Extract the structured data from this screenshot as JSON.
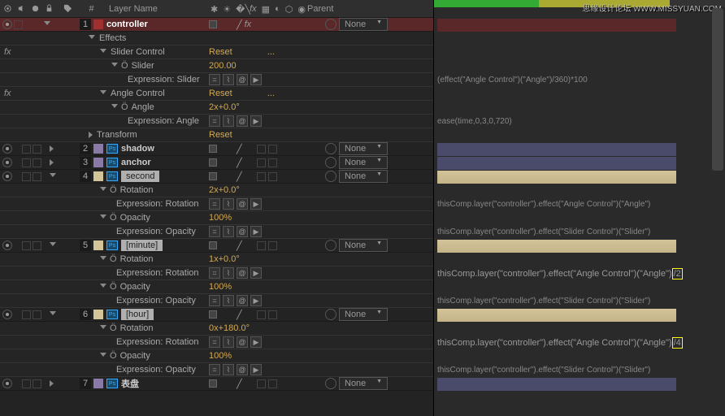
{
  "hdr": {
    "num": "#",
    "name": "Layer Name",
    "parent": "Parent"
  },
  "layers": [
    {
      "n": "1",
      "name": "controller",
      "none": "None",
      "clr": "#a03030"
    },
    {
      "n": "2",
      "name": "shadow",
      "none": "None",
      "clr": "#8a7aa8"
    },
    {
      "n": "3",
      "name": "anchor",
      "none": "None",
      "clr": "#8a7aa8"
    },
    {
      "n": "4",
      "name": "second",
      "none": "None",
      "clr": "#d4c49a"
    },
    {
      "n": "5",
      "name": "[minute]",
      "none": "None",
      "clr": "#d4c49a"
    },
    {
      "n": "6",
      "name": "[hour]",
      "none": "None",
      "clr": "#d4c49a"
    },
    {
      "n": "7",
      "name": "表盘",
      "none": "None",
      "clr": "#8a7aa8"
    }
  ],
  "fx": {
    "effects": "Effects",
    "slider": "Slider Control",
    "sliderP": "Slider",
    "sliderV": "200.00",
    "exprS": "Expression: Slider",
    "angle": "Angle Control",
    "angleP": "Angle",
    "angleV": "2x+0.0°",
    "exprA": "Expression: Angle",
    "transform": "Transform",
    "reset": "Reset"
  },
  "props": {
    "rotation": "Rotation",
    "opacity": "Opacity",
    "exprR": "Expression: Rotation",
    "exprO": "Expression: Opacity",
    "op100": "100%"
  },
  "vals": {
    "r4": "2x+0.0°",
    "r5": "1x+0.0°",
    "r6": "0x+180.0°"
  },
  "exprs": {
    "e1": "(effect(\"Angle Control\")(\"Angle\")/360)*100",
    "e2": "ease(time,0,3,0,720)",
    "e3": "thisComp.layer(\"controller\").effect(\"Angle Control\")(\"Angle\")",
    "e4": "thisComp.layer(\"controller\").effect(\"Slider Control\")(\"Slider\")",
    "e5": "thisComp.layer(\"controller\").effect(\"Angle Control\")(\"Angle\")",
    "e5b": "/2",
    "e6": "thisComp.layer(\"controller\").effect(\"Angle Control\")(\"Angle\")",
    "e6b": "/4"
  },
  "wm": "思缘设计论坛  WWW.MISSYUAN.COM"
}
